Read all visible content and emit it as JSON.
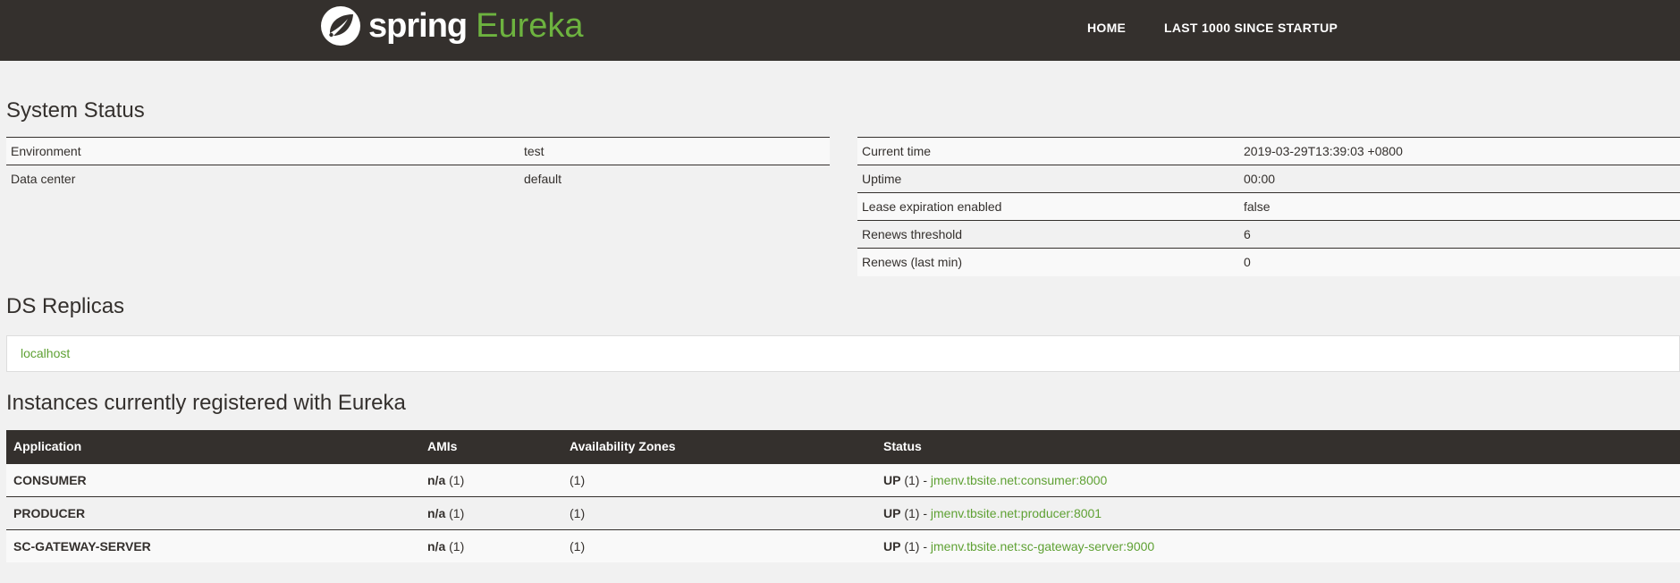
{
  "navbar": {
    "brand_spring": "spring",
    "brand_eureka": "Eureka",
    "logo_icon": "spring-leaf-icon",
    "links": [
      {
        "label": "HOME"
      },
      {
        "label": "LAST 1000 SINCE STARTUP"
      }
    ]
  },
  "system_status": {
    "title": "System Status",
    "left": [
      {
        "key": "Environment",
        "value": "test"
      },
      {
        "key": "Data center",
        "value": "default"
      }
    ],
    "right": [
      {
        "key": "Current time",
        "value": "2019-03-29T13:39:03 +0800"
      },
      {
        "key": "Uptime",
        "value": "00:00"
      },
      {
        "key": "Lease expiration enabled",
        "value": "false"
      },
      {
        "key": "Renews threshold",
        "value": "6"
      },
      {
        "key": "Renews (last min)",
        "value": "0"
      }
    ]
  },
  "ds_replicas": {
    "title": "DS Replicas",
    "items": [
      {
        "label": "localhost"
      }
    ]
  },
  "instances": {
    "title": "Instances currently registered with Eureka",
    "columns": [
      "Application",
      "AMIs",
      "Availability Zones",
      "Status"
    ],
    "rows": [
      {
        "application": "CONSUMER",
        "ami": "n/a",
        "ami_count": "(1)",
        "zones": "(1)",
        "status": "UP",
        "status_count": "(1) - ",
        "instance": "jmenv.tbsite.net:consumer:8000"
      },
      {
        "application": "PRODUCER",
        "ami": "n/a",
        "ami_count": "(1)",
        "zones": "(1)",
        "status": "UP",
        "status_count": "(1) - ",
        "instance": "jmenv.tbsite.net:producer:8001"
      },
      {
        "application": "SC-GATEWAY-SERVER",
        "ami": "n/a",
        "ami_count": "(1)",
        "zones": "(1)",
        "status": "UP",
        "status_count": "(1) - ",
        "instance": "jmenv.tbsite.net:sc-gateway-server:9000"
      }
    ]
  },
  "colors": {
    "navbar": "#34302d",
    "accent_green": "#6db33f",
    "link_green": "#5fa134",
    "page_bg": "#f1f1f1"
  }
}
